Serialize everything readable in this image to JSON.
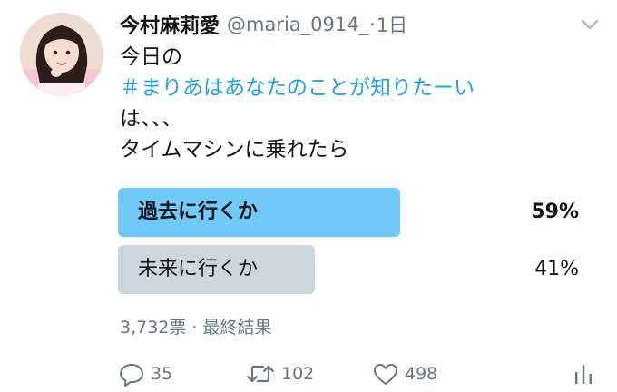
{
  "user": {
    "display_name": "今村麻莉愛",
    "username": "@maria_0914_",
    "separator": "·",
    "timestamp": "1日"
  },
  "tweet": {
    "line1": "今日の",
    "hashtag": "＃まりあはあなたのことが知りたーい",
    "line3": "は、、、",
    "line4": "タイムマシンに乗れたら"
  },
  "poll": {
    "options": [
      {
        "label": "過去に行くか",
        "percent_text": "59%",
        "percent": 59,
        "winner": true
      },
      {
        "label": "未来に行くか",
        "percent_text": "41%",
        "percent": 41,
        "winner": false
      }
    ],
    "meta": "3,732票 · 最終結果"
  },
  "actions": {
    "reply_count": "35",
    "retweet_count": "102",
    "like_count": "498"
  },
  "icons": {
    "caret": "chevron-down-icon",
    "reply": "reply-icon",
    "retweet": "retweet-icon",
    "like": "heart-icon",
    "analytics": "analytics-icon"
  },
  "colors": {
    "hashtag": "#1da1f2",
    "poll_winner": "#71c9f8",
    "poll_other": "#ccd6dd",
    "secondary_text": "#657786"
  }
}
